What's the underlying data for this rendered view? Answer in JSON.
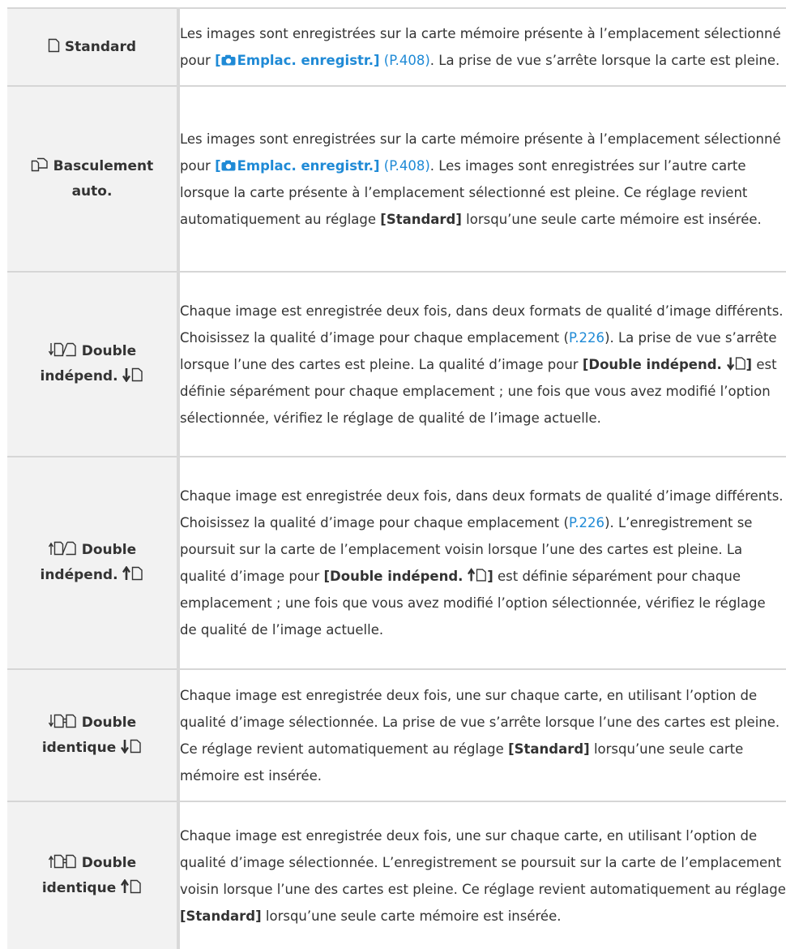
{
  "rows": [
    {
      "label": [
        "Standard"
      ],
      "desc": [
        {
          "t": "Les images sont enregistrées sur la carte mémoire présente à l’emplacement sélectionné pour "
        },
        {
          "t": "[",
          "s": "camlink"
        },
        {
          "t": "Emplac. enregistr.]",
          "s": "camlink",
          "cam": true
        },
        {
          "t": " "
        },
        {
          "t": "(P.408)",
          "s": "link"
        },
        {
          "t": ". La prise de vue s’arrête lorsque la carte est pleine."
        }
      ]
    },
    {
      "label": [
        "Basculement",
        "auto."
      ],
      "desc": [
        {
          "t": "Les images sont enregistrées sur la carte mémoire présente à l’emplacement sélectionné pour "
        },
        {
          "t": "[",
          "s": "camlink"
        },
        {
          "t": "Emplac. enregistr.]",
          "s": "camlink",
          "cam": true
        },
        {
          "t": " "
        },
        {
          "t": "(P.408)",
          "s": "link"
        },
        {
          "t": ". Les images sont enregistrées sur l’autre carte lorsque la carte présente à l’emplacement sélectionné est pleine. Ce réglage revient automatiquement au réglage "
        },
        {
          "t": "[Standard]",
          "s": "b"
        },
        {
          "t": " lorsqu’une seule carte mémoire est insérée."
        }
      ]
    },
    {
      "label": [
        "Double",
        "indépend."
      ],
      "desc": [
        {
          "t": "Chaque image est enregistrée deux fois, dans deux formats de qualité d’image différents. Choisissez la qualité d’image pour chaque emplacement ("
        },
        {
          "t": "P.226",
          "s": "link"
        },
        {
          "t": "). La prise de vue s’arrête lorsque l’une des cartes est pleine. La qualité d’image pour "
        },
        {
          "t": "[Double indépend. ",
          "s": "b"
        },
        {
          "t": "]",
          "s": "b",
          "sym": "down"
        },
        {
          "t": " est définie séparément pour chaque emplacement ; une fois que vous avez modifié l’option sélectionnée, vérifiez le réglage de qualité de l’image actuelle."
        }
      ]
    },
    {
      "label": [
        "Double",
        "indépend."
      ],
      "desc": [
        {
          "t": "Chaque image est enregistrée deux fois, dans deux formats de qualité d’image différents. Choisissez la qualité d’image pour chaque emplacement ("
        },
        {
          "t": "P.226",
          "s": "link"
        },
        {
          "t": "). L’enregistrement se poursuit sur la carte de l’emplacement voisin lorsque l’une des cartes est pleine. La qualité d’image pour "
        },
        {
          "t": "[Double indépend. ",
          "s": "b"
        },
        {
          "t": "]",
          "s": "b",
          "sym": "up"
        },
        {
          "t": " est définie séparément pour chaque emplacement ; une fois que vous avez modifié l’option sélectionnée, vérifiez le réglage de qualité de l’image actuelle."
        }
      ]
    },
    {
      "label": [
        "Double",
        "identique"
      ],
      "desc": [
        {
          "t": "Chaque image est enregistrée deux fois, une sur chaque carte, en utilisant l’option de qualité d’image sélectionnée. La prise de vue s’arrête lorsque l’une des cartes est pleine. Ce réglage revient automatiquement au réglage "
        },
        {
          "t": "[Standard]",
          "s": "b"
        },
        {
          "t": " lorsqu’une seule carte mémoire est insérée."
        }
      ]
    },
    {
      "label": [
        "Double",
        "identique"
      ],
      "desc": [
        {
          "t": "Chaque image est enregistrée deux fois, une sur chaque carte, en utilisant l’option de qualité d’image sélectionnée. L’enregistrement se poursuit sur la carte de l’emplacement voisin lorsque l’une des cartes est pleine. Ce réglage revient automatiquement au réglage "
        },
        {
          "t": "[Standard]",
          "s": "b"
        },
        {
          "t": " lorsqu’une seule carte mémoire est insérée."
        }
      ]
    }
  ],
  "colors": {
    "link": "#1f8ad6",
    "label_bg": "#f2f2f2",
    "border": "#d6d6d6",
    "text": "#333333"
  },
  "icons": [
    "card-single-icon",
    "card-autoswitch-icon",
    "card-dual-independent-down-icon",
    "card-dual-independent-up-icon",
    "card-dual-identical-down-icon",
    "card-dual-identical-up-icon",
    "camera-icon",
    "arrow-down-card-icon",
    "arrow-up-card-icon"
  ]
}
